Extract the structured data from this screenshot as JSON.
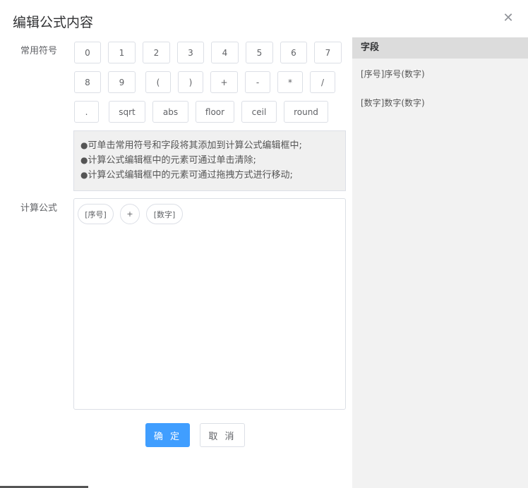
{
  "dialog": {
    "title": "编辑公式内容"
  },
  "labels": {
    "symbols": "常用符号",
    "formula": "计算公式"
  },
  "symbols": [
    "0",
    "1",
    "2",
    "3",
    "4",
    "5",
    "6",
    "7",
    "8",
    "9",
    "(",
    ")",
    "+",
    "-",
    "*",
    "/",
    ".",
    "sqrt",
    "abs",
    "floor",
    "ceil",
    "round"
  ],
  "tips": [
    "可单击常用符号和字段将其添加到计算公式编辑框中;",
    "计算公式编辑框中的元素可通过单击清除;",
    "计算公式编辑框中的元素可通过拖拽方式进行移动;"
  ],
  "tip_bullet": "●",
  "formula_elements": [
    "[序号]",
    "+",
    "[数字]"
  ],
  "buttons": {
    "ok": "确 定",
    "cancel": "取 消"
  },
  "fields_panel": {
    "title": "字段",
    "items": [
      "[序号]序号(数字)",
      "[数字]数字(数字)"
    ]
  },
  "colors": {
    "primary": "#409eff",
    "panel_bg": "#f2f2f2",
    "panel_header": "#dcdcdc"
  },
  "icons": {
    "close": "close-icon"
  }
}
